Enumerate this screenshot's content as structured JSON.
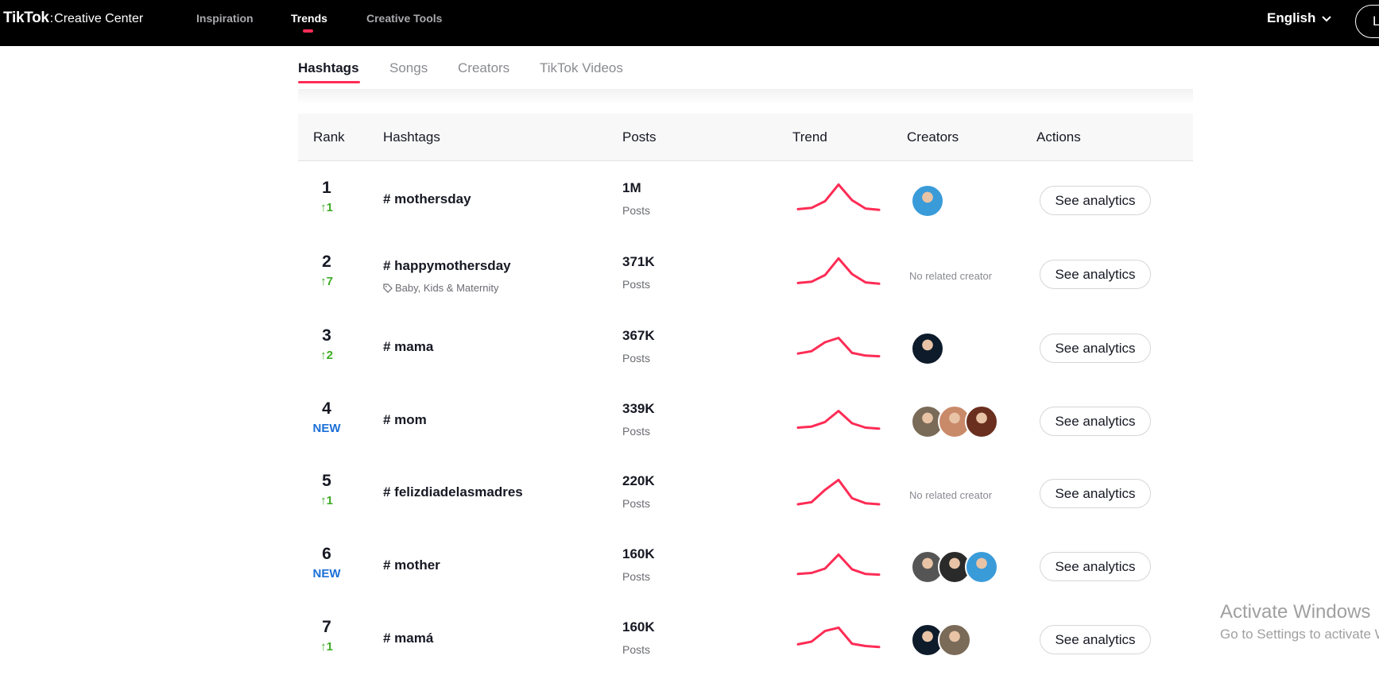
{
  "header": {
    "logo_brand": "TikTok",
    "logo_separator": ":",
    "logo_sub": "Creative Center",
    "nav": [
      "Inspiration",
      "Trends",
      "Creative Tools"
    ],
    "active_nav": "Trends",
    "language": "English",
    "login_label": "Lo"
  },
  "tabs": [
    "Hashtags",
    "Songs",
    "Creators",
    "TikTok Videos"
  ],
  "active_tab": "Hashtags",
  "table": {
    "columns": [
      "Rank",
      "Hashtags",
      "Posts",
      "Trend",
      "Creators",
      "Actions"
    ],
    "rows": [
      {
        "rank": "1",
        "change": "↑1",
        "change_type": "up",
        "hashtag": "# mothersday",
        "category": "",
        "posts": "1M",
        "posts_label": "Posts",
        "trend": [
          0.18,
          0.22,
          0.42,
          0.92,
          0.45,
          0.2,
          0.16
        ],
        "creators": [
          "creator-avatar"
        ],
        "no_creator_text": "",
        "action": "See analytics"
      },
      {
        "rank": "2",
        "change": "↑7",
        "change_type": "up",
        "hashtag": "# happymothersday",
        "category": "Baby, Kids & Maternity",
        "posts": "371K",
        "posts_label": "Posts",
        "trend": [
          0.18,
          0.22,
          0.42,
          0.92,
          0.45,
          0.2,
          0.16
        ],
        "creators": [],
        "no_creator_text": "No related creator",
        "action": "See analytics"
      },
      {
        "rank": "3",
        "change": "↑2",
        "change_type": "up",
        "hashtag": "# mama",
        "category": "",
        "posts": "367K",
        "posts_label": "Posts",
        "trend": [
          0.28,
          0.35,
          0.62,
          0.75,
          0.3,
          0.22,
          0.2
        ],
        "creators": [
          "creator-avatar"
        ],
        "no_creator_text": "",
        "action": "See analytics"
      },
      {
        "rank": "4",
        "change": "NEW",
        "change_type": "new",
        "hashtag": "# mom",
        "category": "",
        "posts": "339K",
        "posts_label": "Posts",
        "trend": [
          0.25,
          0.28,
          0.42,
          0.75,
          0.38,
          0.25,
          0.22
        ],
        "creators": [
          "creator-avatar",
          "creator-avatar",
          "creator-avatar"
        ],
        "no_creator_text": "",
        "action": "See analytics"
      },
      {
        "rank": "5",
        "change": "↑1",
        "change_type": "up",
        "hashtag": "# felizdiadelasmadres",
        "category": "",
        "posts": "220K",
        "posts_label": "Posts",
        "trend": [
          0.12,
          0.18,
          0.55,
          0.85,
          0.3,
          0.15,
          0.12
        ],
        "creators": [],
        "no_creator_text": "No related creator",
        "action": "See analytics"
      },
      {
        "rank": "6",
        "change": "NEW",
        "change_type": "new",
        "hashtag": "# mother",
        "category": "",
        "posts": "160K",
        "posts_label": "Posts",
        "trend": [
          0.22,
          0.25,
          0.38,
          0.8,
          0.36,
          0.22,
          0.2
        ],
        "creators": [
          "creator-avatar",
          "creator-avatar",
          "creator-avatar"
        ],
        "no_creator_text": "",
        "action": "See analytics"
      },
      {
        "rank": "7",
        "change": "↑1",
        "change_type": "up",
        "hashtag": "# mamá",
        "category": "",
        "posts": "160K",
        "posts_label": "Posts",
        "trend": [
          0.3,
          0.38,
          0.7,
          0.8,
          0.32,
          0.25,
          0.22
        ],
        "creators": [
          "creator-avatar",
          "creator-avatar"
        ],
        "no_creator_text": "",
        "action": "See analytics"
      }
    ]
  },
  "watermark": {
    "title": "Activate Windows",
    "subtitle": "Go to Settings to activate Windows."
  },
  "colors": {
    "accent": "#fe2c55",
    "rank_up": "#3eab24",
    "rank_new": "#1a6fd8",
    "avatar_palette": [
      "#3a9bd9",
      "#0d1b2a",
      "#7a6a58",
      "#c98a6a",
      "#6b2f1f",
      "#555555",
      "#2a2a2a"
    ]
  }
}
